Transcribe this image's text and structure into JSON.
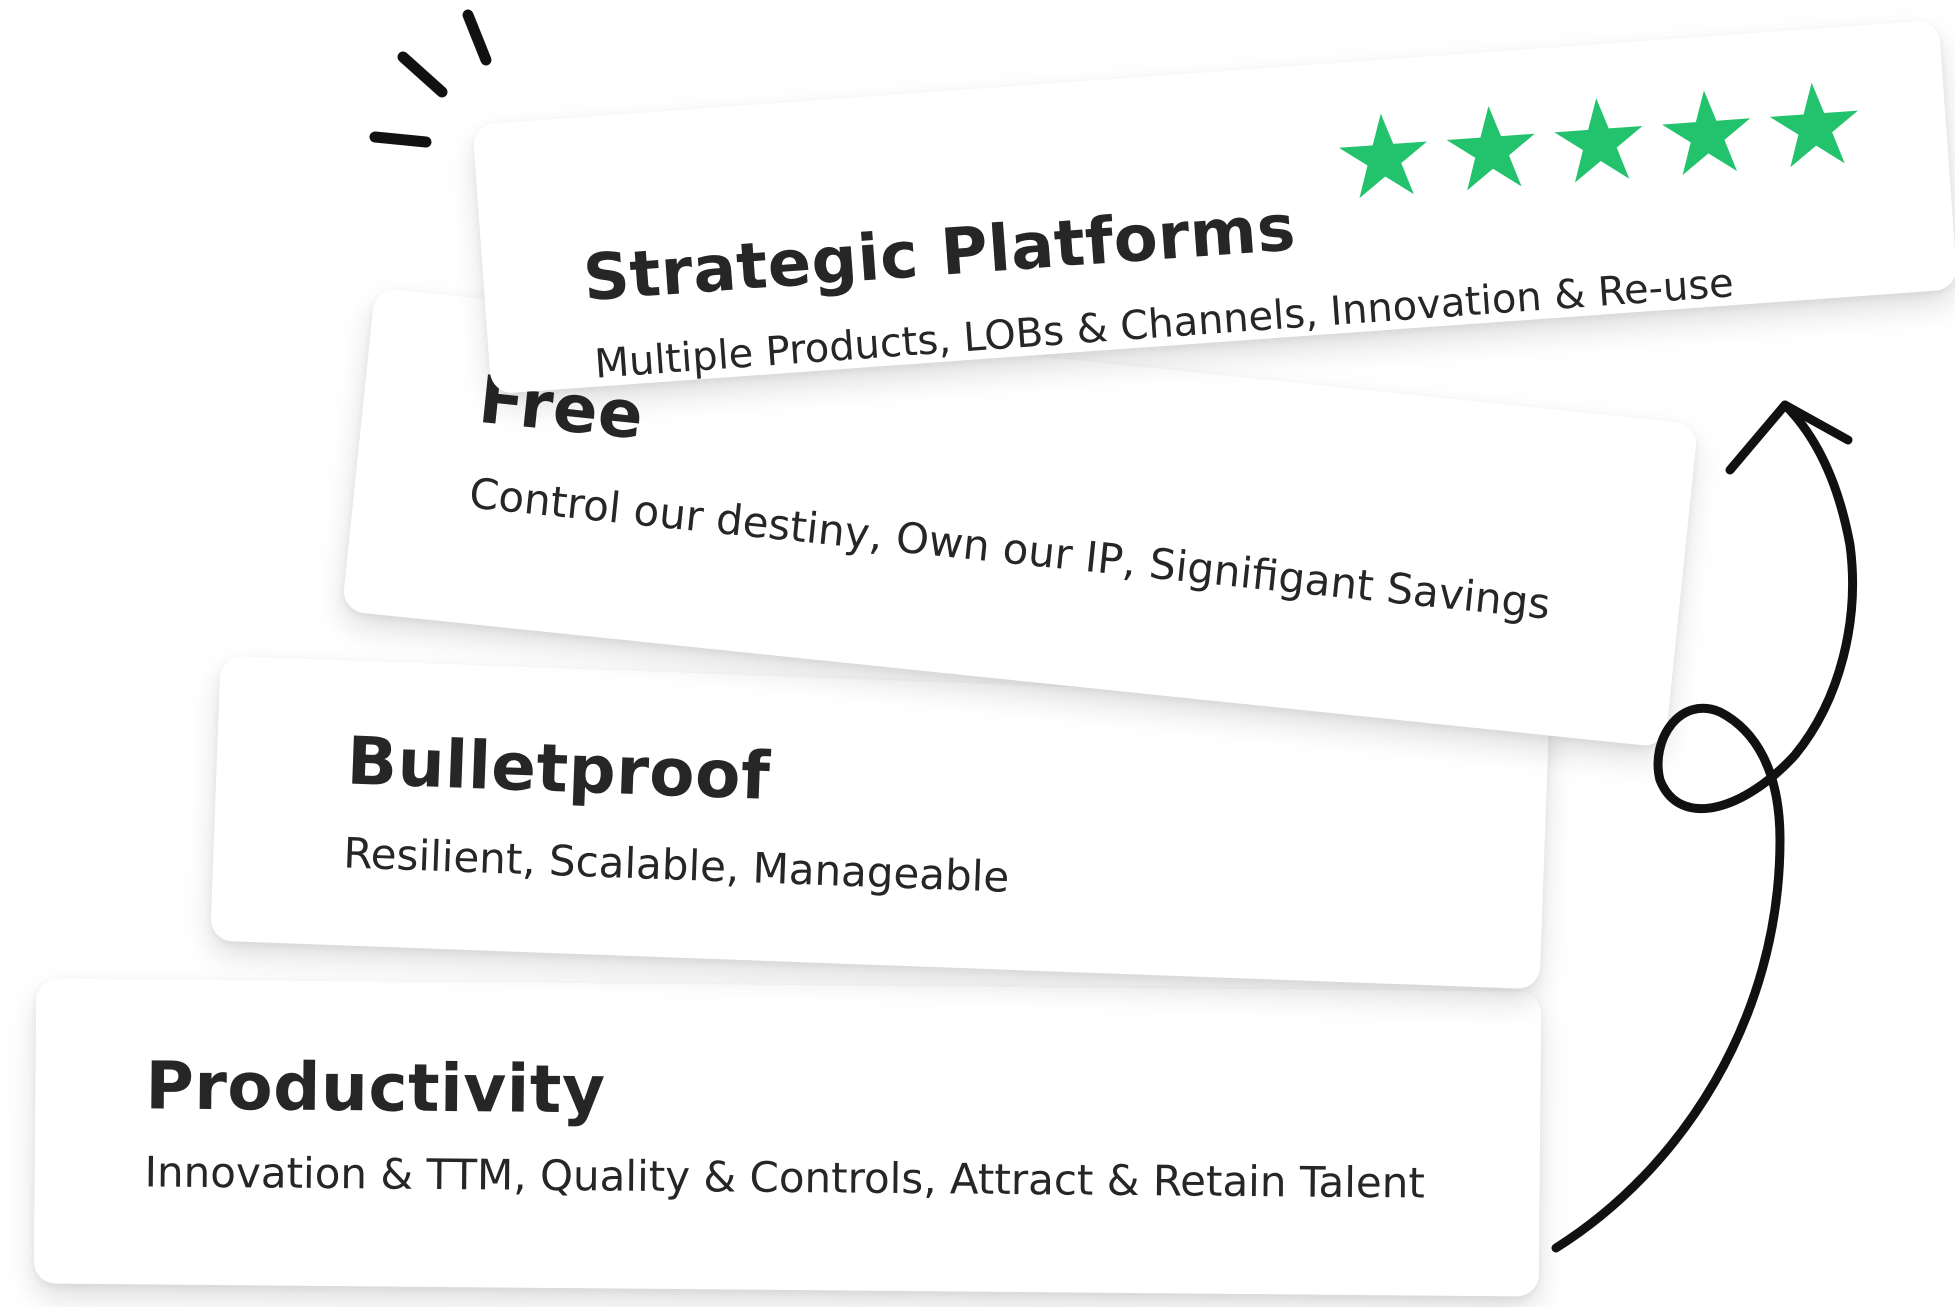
{
  "cards": [
    {
      "id": "strategic",
      "title": "Strategic Platforms",
      "subtitle": "Multiple Products, LOBs & Channels, Innovation & Re-use"
    },
    {
      "id": "free",
      "title": "Free",
      "subtitle": "Control our destiny, Own our IP, Signifigant Savings"
    },
    {
      "id": "bulletproof",
      "title": "Bulletproof",
      "subtitle": "Resilient, Scalable, Manageable"
    },
    {
      "id": "productivity",
      "title": "Productivity",
      "subtitle": "Innovation & TTM, Quality & Controls, Attract & Retain Talent"
    }
  ],
  "rating": {
    "stars": 5,
    "max": 5,
    "icon": "star-icon"
  },
  "colors": {
    "star": "#22c36c",
    "text": "#262626",
    "card": "#ffffff",
    "arrow": "#111111"
  },
  "decorations": {
    "arrow_icon": "curly-arrow-up-icon",
    "sparkle_icon": "sparkle-lines-icon"
  }
}
